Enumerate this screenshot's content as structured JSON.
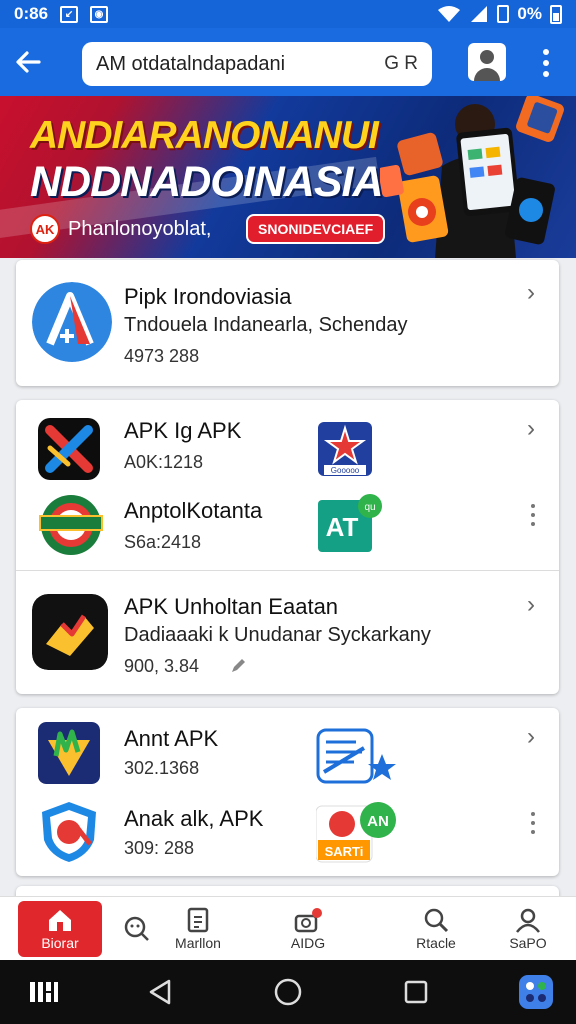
{
  "status_bar": {
    "time": "0:86",
    "battery": "0%",
    "colors": {
      "bar": "#1565d8"
    }
  },
  "app_bar": {
    "search_text": "AM otdatalndapadani",
    "search_tail": "G R",
    "color": "#1a6be0"
  },
  "banner": {
    "title_line1": "ANDIARANONANUI",
    "title_line2": "NDDNADOINASIA",
    "badge_logo": "AK",
    "subtitle": "Phanlonoyoblat,",
    "button": "SNONIDEVCIAEF"
  },
  "featured": {
    "title": "Pipk Irondoviasia",
    "subtitle": "Tndouela Indanearla, Schenday",
    "size": "4973 288"
  },
  "apps_group1": [
    {
      "title": "APK Ig APK",
      "size": "A0K:1218",
      "icon": "x-logo-icon",
      "side_icon": "star-icon"
    },
    {
      "title": "AnptolKotanta",
      "size": "S6a:2418",
      "icon": "badge-logo-icon",
      "side_icon": "at-logo-icon"
    }
  ],
  "apps_single": {
    "title": "APK Unholtan Eaatan",
    "subtitle": "Dadiaaaki k Unudanar Syckarkany",
    "size": "900, 3.84"
  },
  "apps_group2": [
    {
      "title": "Annt APK",
      "size": "302.1368",
      "icon": "triangle-logo-icon",
      "side_icon": "gear-star-icon"
    },
    {
      "title": "Anak alk, APK",
      "size": "309: 288",
      "icon": "shield-logo-icon",
      "side_icon": "sarti-icon"
    }
  ],
  "mini_labels": {
    "star_caption": "Gooooo",
    "at_text": "AT",
    "at_bubble": "qu",
    "sarti_text": "SARTi",
    "sarti_bubble": "AN"
  },
  "bottom_nav": [
    {
      "label": "Biorar",
      "icon": "home-icon",
      "active": true
    },
    {
      "label": "",
      "icon": "search-face-icon",
      "active": false
    },
    {
      "label": "Marllon",
      "icon": "document-icon",
      "active": false
    },
    {
      "label": "AIDG",
      "icon": "camera-icon",
      "active": false
    },
    {
      "label": "Rtacle",
      "icon": "search-icon",
      "active": false
    },
    {
      "label": "SaPO",
      "icon": "profile-icon",
      "active": false
    }
  ],
  "accent": "#e0272b"
}
